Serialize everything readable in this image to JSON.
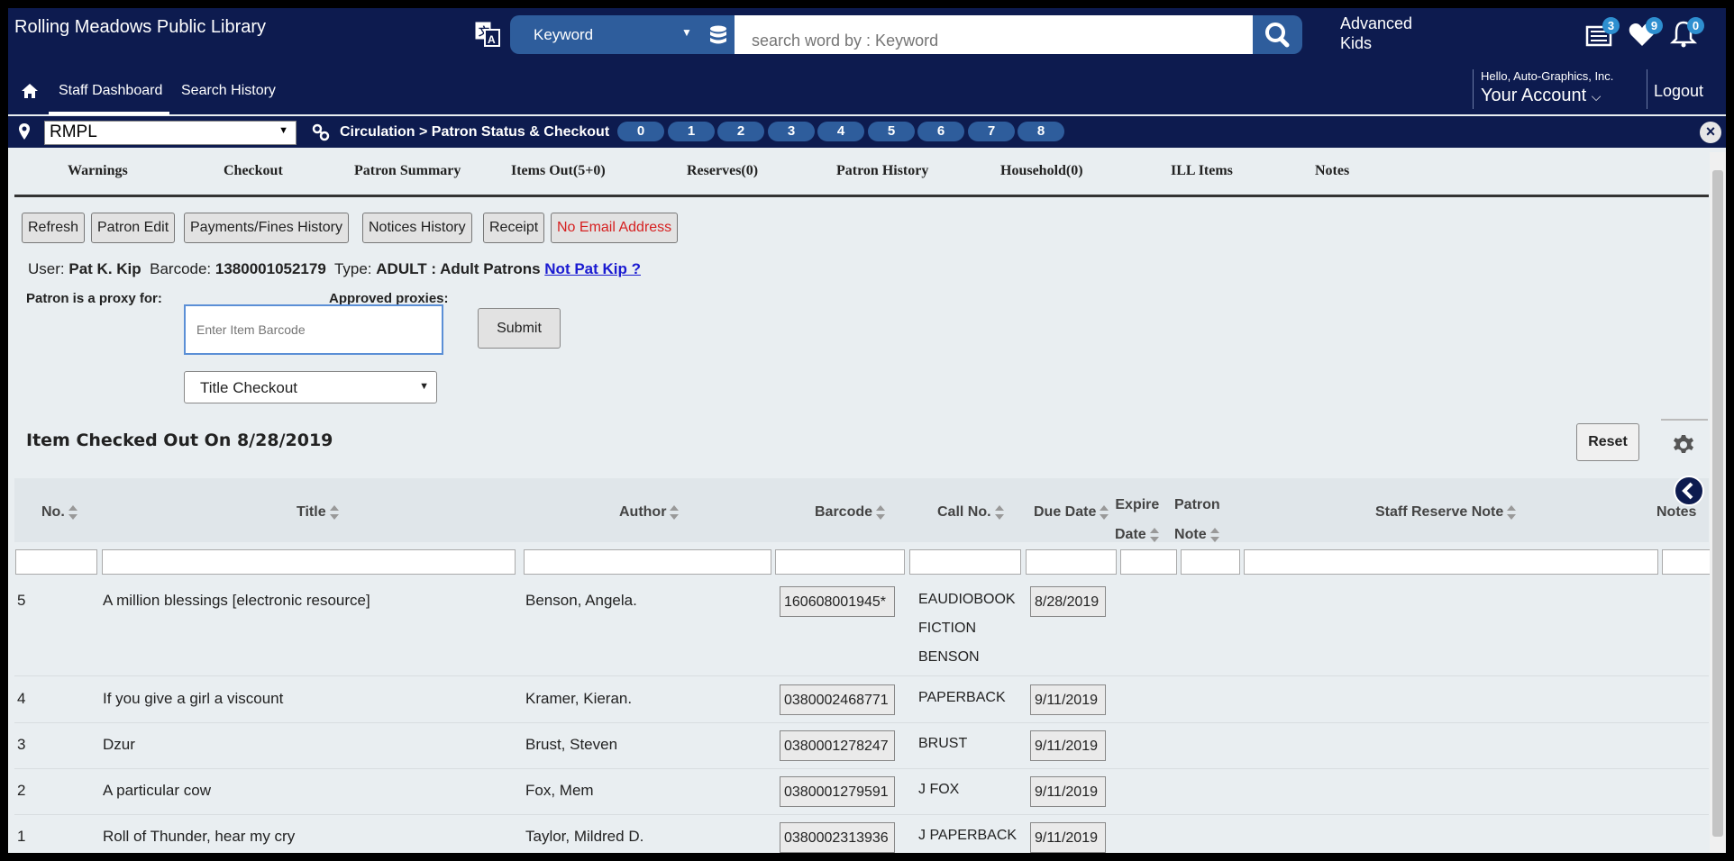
{
  "header": {
    "app_title": "Rolling Meadows Public Library",
    "search_type": "Keyword",
    "search_placeholder": "search word by : Keyword",
    "advanced_label": "Advanced",
    "kids_label": "Kids",
    "list_count": "3",
    "favorites_count": "9",
    "notifications_count": "0",
    "nav": {
      "dashboard": "Staff Dashboard",
      "history": "Search History"
    },
    "hello": "Hello, Auto-Graphics, Inc.",
    "account": "Your Account",
    "logout": "Logout"
  },
  "locbar": {
    "branch": "RMPL",
    "breadcrumb": "Circulation > Patron Status & Checkout",
    "slots": [
      "0",
      "1",
      "2",
      "3",
      "4",
      "5",
      "6",
      "7",
      "8"
    ]
  },
  "tabs": [
    "Warnings",
    "Checkout",
    "Patron Summary",
    "Items Out(5+0)",
    "Reserves(0)",
    "Patron History",
    "Household(0)",
    "ILL Items",
    "Notes"
  ],
  "actions": {
    "refresh": "Refresh",
    "patron_edit": "Patron Edit",
    "payments": "Payments/Fines History",
    "notices": "Notices History",
    "receipt": "Receipt",
    "no_email": "No Email Address"
  },
  "patron": {
    "user_label": "User:",
    "user": "Pat K. Kip",
    "barcode_label": "Barcode:",
    "barcode": "1380001052179",
    "type_label": "Type:",
    "type": "ADULT : Adult Patrons",
    "not_link": "Not Pat Kip ?",
    "proxy_for_label": "Patron is a proxy for:",
    "approved_label": "Approved proxies:"
  },
  "checkout": {
    "barcode_placeholder": "Enter Item Barcode",
    "submit": "Submit",
    "mode": "Title Checkout",
    "section_title": "Item Checked Out On 8/28/2019",
    "reset": "Reset"
  },
  "table": {
    "headers": {
      "no": "No.",
      "title": "Title",
      "author": "Author",
      "barcode": "Barcode",
      "call_no": "Call No.",
      "due_date": "Due Date",
      "expire_1": "Expire",
      "expire_2": "Date",
      "patron_note_1": "Patron",
      "patron_note_2": "Note",
      "staff_note": "Staff Reserve Note",
      "notes": "Notes"
    },
    "rows": [
      {
        "no": "5",
        "title": "A million blessings [electronic resource]",
        "author": "Benson, Angela.",
        "barcode": "160608001945*",
        "call_1": "EAUDIOBOOK",
        "call_2": "FICTION",
        "call_3": "BENSON",
        "due": "8/28/2019"
      },
      {
        "no": "4",
        "title": "If you give a girl a viscount",
        "author": "Kramer, Kieran.",
        "barcode": "0380002468771",
        "call_1": "PAPERBACK",
        "due": "9/11/2019"
      },
      {
        "no": "3",
        "title": "Dzur",
        "author": "Brust, Steven",
        "barcode": "0380001278247",
        "call_1": "BRUST",
        "due": "9/11/2019"
      },
      {
        "no": "2",
        "title": "A particular cow",
        "author": "Fox, Mem",
        "barcode": "0380001279591",
        "call_1": "J FOX",
        "due": "9/11/2019"
      },
      {
        "no": "1",
        "title": "Roll of Thunder, hear my cry",
        "author": "Taylor, Mildred D.",
        "barcode": "0380002313936",
        "call_1": "J PAPERBACK",
        "due": "9/11/2019"
      }
    ]
  },
  "icons": {
    "home": "home-icon",
    "translate": "translate-icon",
    "database": "database-icon",
    "search": "search-icon",
    "list": "list-icon",
    "heart": "heart-icon",
    "bell": "bell-icon",
    "pin": "location-pin-icon",
    "link": "link-icon",
    "close": "close-icon",
    "gear": "gear-icon",
    "back": "chevron-left-icon",
    "sort": "sort-icon"
  },
  "colors": {
    "navy": "#0d1b4f",
    "accent": "#2e5d9c",
    "badge": "#2e8fd0",
    "warning_text": "#d62020"
  }
}
